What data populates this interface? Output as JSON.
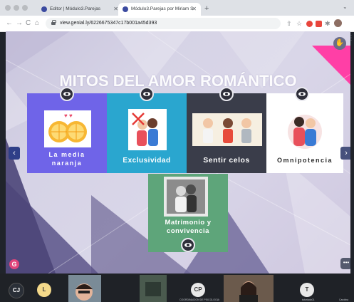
{
  "browser": {
    "tabs": [
      {
        "title": "Editor | Módulo3.Parejas",
        "active": false
      },
      {
        "title": "Módulo3.Parejas por Miriam S",
        "active": true
      }
    ],
    "new_tab_label": "+",
    "url": "view.genial.ly/6226675347c17b001a45d393",
    "nav": {
      "back": "←",
      "forward": "→",
      "reload": "C",
      "home": "⌂"
    }
  },
  "presentation": {
    "title": "MITOS DEL AMOR ROMÁNTICO",
    "cards": [
      {
        "label_line1": "La media",
        "label_line2": "naranja",
        "color": "#6f64e8"
      },
      {
        "label": "Exclusividad",
        "color": "#2aa6cf"
      },
      {
        "label": "Sentir celos",
        "color": "#3a3d4a"
      },
      {
        "label": "Omnipotencia",
        "color": "#ffffff"
      },
      {
        "label_line1": "Matrimonio y",
        "label_line2": "convivencia",
        "color": "#5ea57a"
      }
    ],
    "prev_arrow": "‹",
    "next_arrow": "›",
    "more_label": "•••"
  },
  "participants": [
    {
      "initials": "CJ",
      "color": "#2a2f37",
      "text_color": "#ffffff"
    },
    {
      "initials": "L",
      "color": "#f4d98a",
      "text_color": "#3a3a3a"
    },
    {
      "initials": "CP",
      "color": "#e8e8e8",
      "text_color": "#3a3a3a",
      "name": "COORDINACION DE PSICOLOGIA"
    },
    {
      "initials": "T",
      "color": "#e8e8e8",
      "text_color": "#3a3a3a",
      "name": "tutoriado01"
    },
    {
      "name": "Carolina"
    }
  ]
}
